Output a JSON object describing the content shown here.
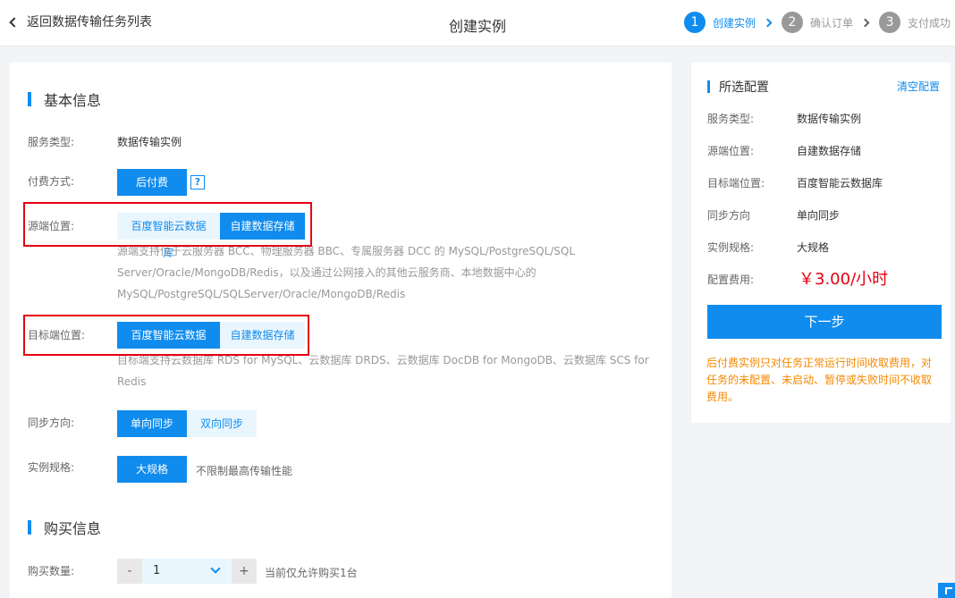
{
  "header": {
    "back_label": "返回数据传输任务列表",
    "title": "创建实例",
    "steps": [
      {
        "num": "1",
        "label": "创建实例"
      },
      {
        "num": "2",
        "label": "确认订单"
      },
      {
        "num": "3",
        "label": "支付成功"
      }
    ]
  },
  "basic": {
    "title": "基本信息",
    "service_type_label": "服务类型:",
    "service_type_value": "数据传输实例",
    "payment_label": "付费方式:",
    "payment_option": "后付费",
    "help": "?",
    "source_label": "源端位置:",
    "source_options": [
      "百度智能云数据库",
      "自建数据存储"
    ],
    "source_desc": "源端支持位于云服务器 BCC、物理服务器 BBC、专属服务器 DCC 的 MySQL/PostgreSQL/SQL Server/Oracle/MongoDB/Redis，以及通过公网接入的其他云服务商、本地数据中心的 MySQL/PostgreSQL/SQLServer/Oracle/MongoDB/Redis",
    "target_label": "目标端位置:",
    "target_options": [
      "百度智能云数据库",
      "自建数据存储"
    ],
    "target_desc": "目标端支持云数据库 RDS for MySQL、云数据库 DRDS、云数据库 DocDB for MongoDB、云数据库 SCS for Redis",
    "sync_label": "同步方向:",
    "sync_options": [
      "单向同步",
      "双向同步"
    ],
    "spec_label": "实例规格:",
    "spec_option": "大规格",
    "spec_note": "不限制最高传输性能"
  },
  "purchase": {
    "title": "购买信息",
    "quantity_label": "购买数量:",
    "minus": "-",
    "plus": "+",
    "quantity": "1",
    "quantity_note": "当前仅允许购买1台"
  },
  "side": {
    "title": "所选配置",
    "clear": "清空配置",
    "rows": [
      {
        "label": "服务类型:",
        "value": "数据传输实例"
      },
      {
        "label": "源端位置:",
        "value": "自建数据存储"
      },
      {
        "label": "目标端位置:",
        "value": "百度智能云数据库"
      },
      {
        "label": "同步方向",
        "value": "单向同步"
      },
      {
        "label": "实例规格:",
        "value": "大规格"
      }
    ],
    "fee_label": "配置费用:",
    "price": "￥3.00/小时",
    "next": "下一步",
    "note": "后付费实例只对任务正常运行时间收取费用，对任务的未配置、未启动、暂停或失败时间不收取费用。"
  },
  "colors": {
    "accent": "#108cee",
    "highlight": "#e60012",
    "warning": "#f38900"
  }
}
